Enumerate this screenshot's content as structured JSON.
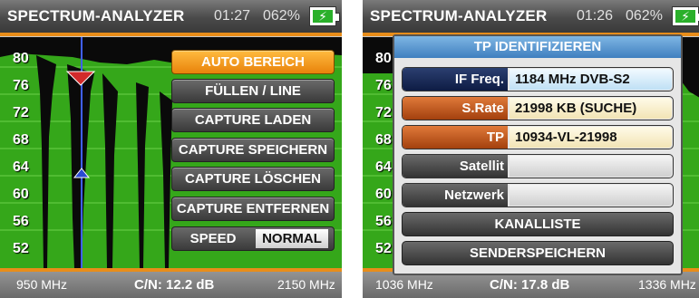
{
  "left": {
    "title": "SPECTRUM-ANALYZER",
    "time": "01:27",
    "battery": "062%",
    "y_labels": [
      "80",
      "76",
      "72",
      "68",
      "64",
      "60",
      "56",
      "52"
    ],
    "menu": {
      "auto_range": "AUTO BEREICH",
      "fill_line": "FÜLLEN / LINE",
      "capture_load": "CAPTURE LADEN",
      "capture_save": "CAPTURE SPEICHERN",
      "capture_delete": "CAPTURE LÖSCHEN",
      "capture_remove": "CAPTURE ENTFERNEN",
      "speed_label": "SPEED",
      "speed_value": "NORMAL"
    },
    "footer": {
      "start": "950 MHz",
      "cn": "C/N: 12.2 dB",
      "end": "2150 MHz"
    }
  },
  "right": {
    "title": "SPECTRUM-ANALYZER",
    "time": "01:26",
    "battery": "062%",
    "y_labels": [
      "80",
      "76",
      "72",
      "68",
      "64",
      "60",
      "56",
      "52"
    ],
    "dialog": {
      "title": "TP IDENTIFIZIEREN",
      "if_label": "IF Freq.",
      "if_value": "1184 MHz DVB-S2",
      "srate_label": "S.Rate",
      "srate_value": "21998 KB (SUCHE)",
      "tp_label": "TP",
      "tp_value": "10934-VL-21998",
      "sat_label": "Satellit",
      "sat_value": "",
      "net_label": "Netzwerk",
      "net_value": "",
      "channel_list": "KANALLISTE",
      "save_channels": "SENDERSPEICHERN"
    },
    "footer": {
      "start": "1036 MHz",
      "cn": "C/N: 17.8 dB",
      "end": "1336 MHz"
    }
  },
  "colors": {
    "accent": "#e88d1a",
    "spectrum": "#35a71a",
    "plot_grid": "#6bd24a"
  }
}
